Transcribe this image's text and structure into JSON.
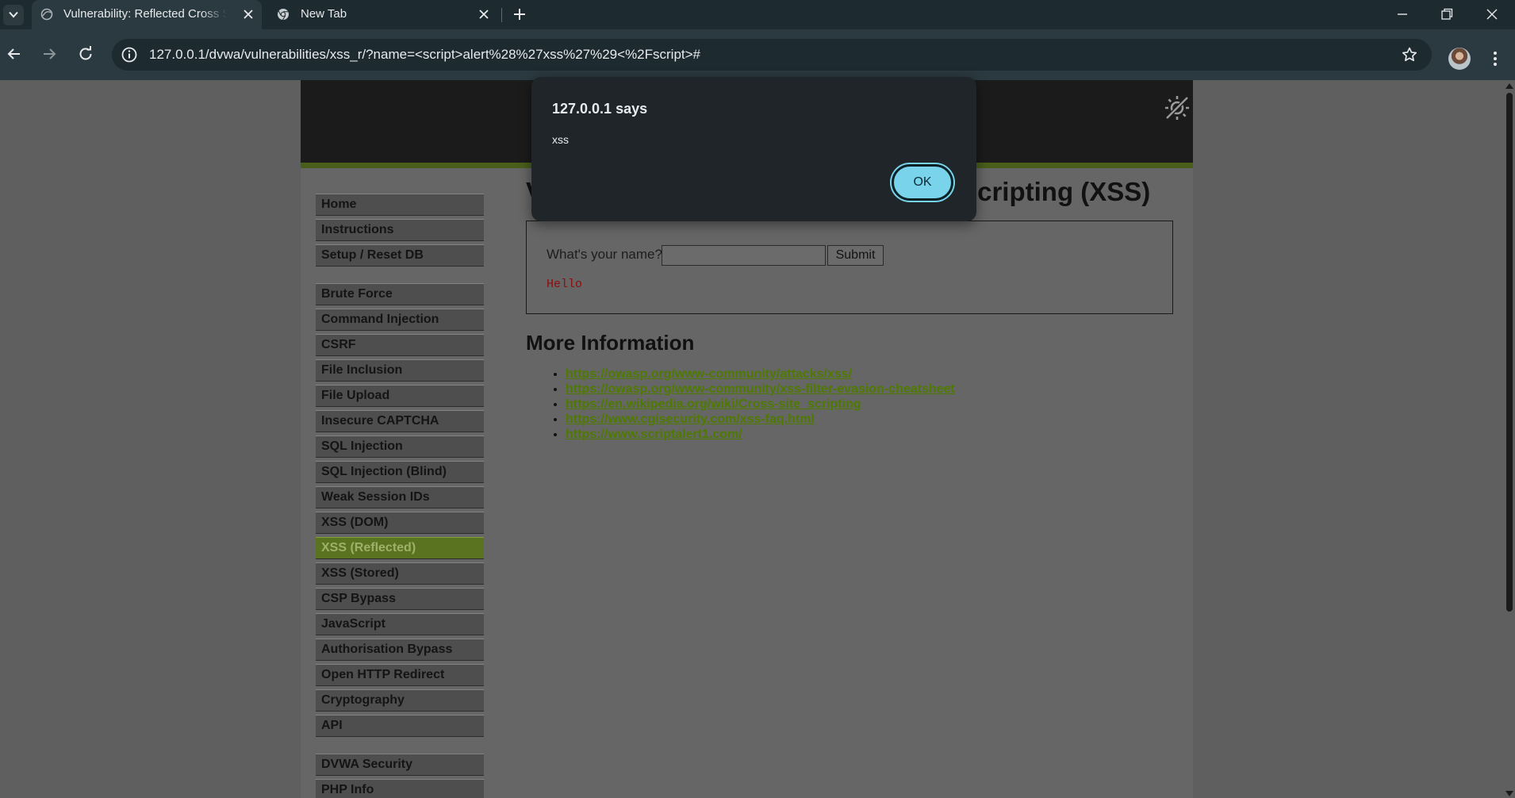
{
  "browser": {
    "tabs": [
      {
        "title": "Vulnerability: Reflected Cross Site Scripting (XSS) :: Damn Vulnerable Web Application (DVWA)",
        "active": true
      },
      {
        "title": "New Tab",
        "active": false
      }
    ],
    "url": "127.0.0.1/dvwa/vulnerabilities/xss_r/?name=<script>alert%28%27xss%27%29<%2Fscript>#"
  },
  "menu": {
    "groups": [
      [
        "Home",
        "Instructions",
        "Setup / Reset DB"
      ],
      [
        "Brute Force",
        "Command Injection",
        "CSRF",
        "File Inclusion",
        "File Upload",
        "Insecure CAPTCHA",
        "SQL Injection",
        "SQL Injection (Blind)",
        "Weak Session IDs",
        "XSS (DOM)",
        "XSS (Reflected)",
        "XSS (Stored)",
        "CSP Bypass",
        "JavaScript",
        "Authorisation Bypass",
        "Open HTTP Redirect",
        "Cryptography",
        "API"
      ],
      [
        "DVWA Security",
        "PHP Info"
      ]
    ],
    "selected": "XSS (Reflected)"
  },
  "main": {
    "heading": "Vulnerability: Reflected Cross Site Scripting (XSS)",
    "form": {
      "label": "What's your name?",
      "input_value": "",
      "submit_label": "Submit"
    },
    "output": "Hello",
    "more_info_heading": "More Information",
    "links": [
      "https://owasp.org/www-community/attacks/xss/",
      "https://owasp.org/www-community/xss-filter-evasion-cheatsheet",
      "https://en.wikipedia.org/wiki/Cross-site_scripting",
      "https://www.cgisecurity.com/xss-faq.html",
      "https://www.scriptalert1.com/"
    ]
  },
  "dialog": {
    "title": "127.0.0.1 says",
    "message": "xss",
    "ok_label": "OK"
  },
  "colors": {
    "accent": "#79d3ea",
    "selected_menu": "#5a7320",
    "link": "#4f7a00",
    "output": "#8e0d0d"
  }
}
